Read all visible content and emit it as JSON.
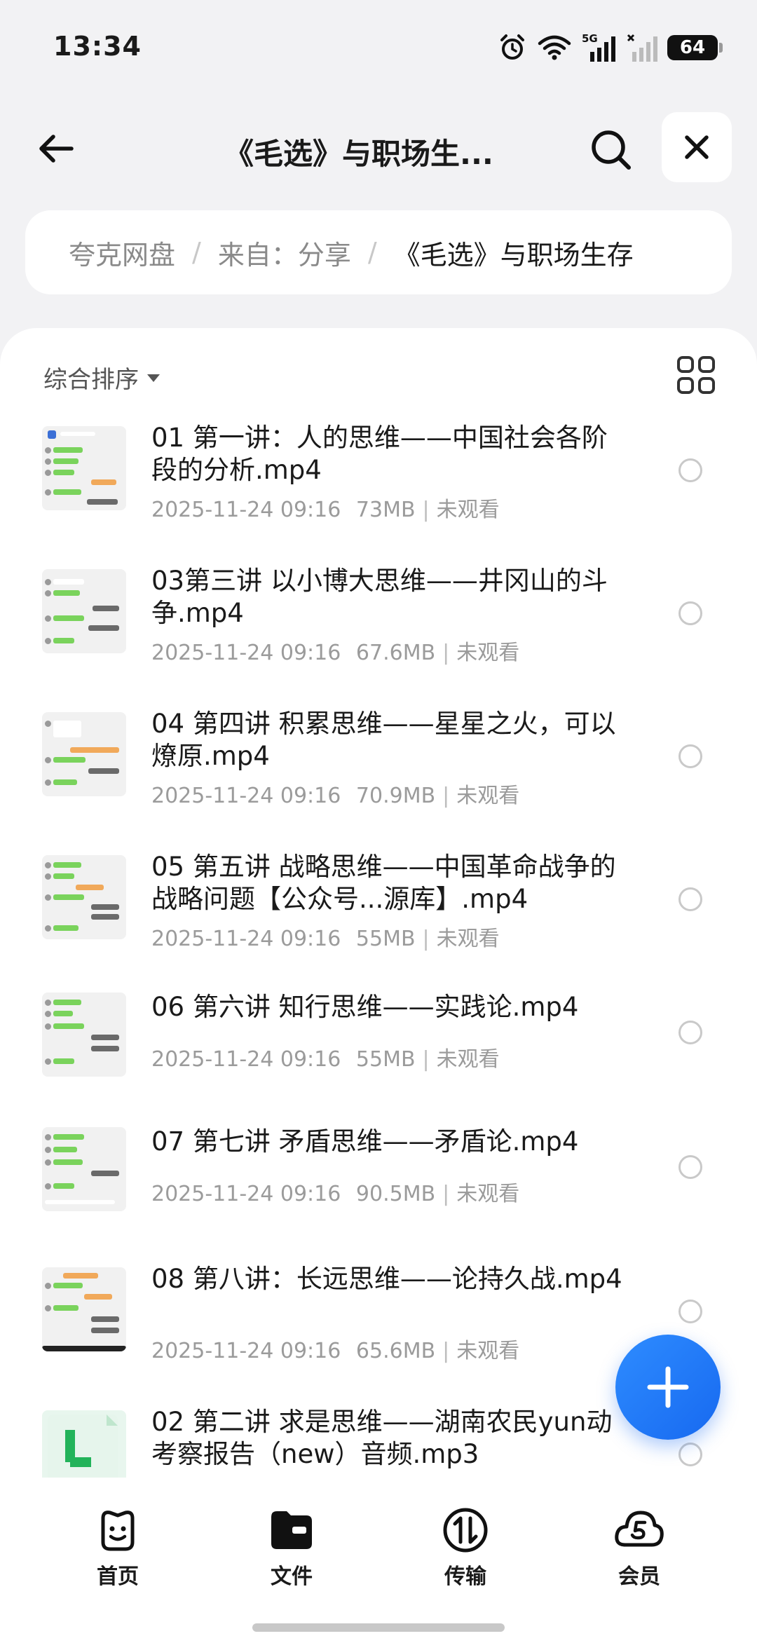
{
  "status_bar": {
    "time": "13:34",
    "battery": "64",
    "network_label": "5G",
    "icons": [
      "alarm-icon",
      "wifi-icon",
      "signal-5g-icon",
      "signal-icon",
      "battery-icon"
    ]
  },
  "header": {
    "title": "《毛选》与职场生...",
    "back_icon": "arrow-left-icon",
    "search_icon": "search-icon",
    "close_icon": "close-icon"
  },
  "breadcrumb": {
    "items": [
      "夸克网盘",
      "来自：分享",
      "《毛选》与职场生存"
    ],
    "separator": "/"
  },
  "toolbar": {
    "sort_label": "综合排序",
    "view_toggle_icon": "grid-view-icon"
  },
  "files": [
    {
      "name": "01 第一讲：人的思维——中国社会各阶段的分析.mp4",
      "date": "2025-11-24 09:16",
      "size": "73MB",
      "status": "未观看"
    },
    {
      "name": "03第三讲 以小博大思维——井冈山的斗争.mp4",
      "date": "2025-11-24 09:16",
      "size": "67.6MB",
      "status": "未观看"
    },
    {
      "name": "04  第四讲 积累思维——星星之火，可以燎原.mp4",
      "date": "2025-11-24 09:16",
      "size": "70.9MB",
      "status": "未观看"
    },
    {
      "name": "05 第五讲 战略思维——中国革命战争的战略问题【公众号...源库】.mp4",
      "date": "2025-11-24 09:16",
      "size": "55MB",
      "status": "未观看"
    },
    {
      "name": "06 第六讲 知行思维——实践论.mp4",
      "date": "2025-11-24 09:16",
      "size": "55MB",
      "status": "未观看"
    },
    {
      "name": "07 第七讲 矛盾思维——矛盾论.mp4",
      "date": "2025-11-24 09:16",
      "size": "90.5MB",
      "status": "未观看"
    },
    {
      "name": "08 第八讲：长远思维——论持久战.mp4",
      "date": "2025-11-24 09:16",
      "size": "65.6MB",
      "status": "未观看"
    },
    {
      "name": "02 第二讲 求是思维——湖南农民yun动考察报告（new）音频.mp3",
      "date": "",
      "size": "",
      "status": ""
    }
  ],
  "fab": {
    "icon": "plus-icon"
  },
  "bottom_nav": {
    "items": [
      {
        "label": "首页",
        "icon": "smile-face-icon"
      },
      {
        "label": "文件",
        "icon": "folder-icon"
      },
      {
        "label": "传输",
        "icon": "transfer-icon"
      },
      {
        "label": "会员",
        "icon": "cloud-vip-icon"
      }
    ],
    "active_index": 1
  },
  "colors": {
    "accent": "#1769f0",
    "background": "#f2f2f4",
    "text_primary": "#1a1a1a",
    "text_secondary": "#9b9b9b"
  }
}
